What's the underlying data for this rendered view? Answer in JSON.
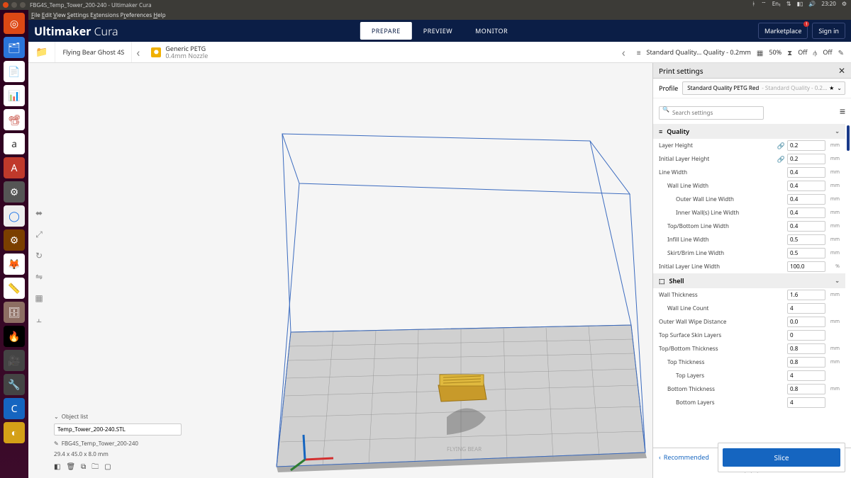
{
  "window": {
    "title": "FBG4S_Temp_Tower_200-240 - Ultimaker Cura"
  },
  "wm_circles": [
    "#df4a16",
    "#5b5750",
    "#5b5750"
  ],
  "tray": {
    "lang": "En₁",
    "time": "23:20"
  },
  "menubar": [
    "File",
    "Edit",
    "View",
    "Settings",
    "Extensions",
    "Preferences",
    "Help"
  ],
  "launcher": [
    {
      "bg": "#dd4814",
      "glyph": "◎"
    },
    {
      "bg": "#2a74da",
      "glyph": "🗂"
    },
    {
      "bg": "#0b6e4f",
      "glyph": "📗"
    },
    {
      "bg": "#ffffff",
      "glyph": "📝"
    },
    {
      "bg": "#0b6e4f",
      "glyph": "📊"
    },
    {
      "bg": "#c0392b",
      "glyph": "📽"
    },
    {
      "bg": "#ffffff",
      "glyph": "a"
    },
    {
      "bg": "#c0392b",
      "glyph": "🛍"
    },
    {
      "bg": "#555",
      "glyph": "⚙"
    },
    {
      "bg": "#ddd",
      "glyph": "🌐"
    },
    {
      "bg": "#7b3f00",
      "glyph": "⚙"
    },
    {
      "bg": "#ff7043",
      "glyph": "🦊"
    },
    {
      "bg": "#ddd",
      "glyph": "📏"
    },
    {
      "bg": "#8d6e63",
      "glyph": "🗄"
    },
    {
      "bg": "#000",
      "glyph": "🔥"
    },
    {
      "bg": "#444",
      "glyph": "🎥"
    },
    {
      "bg": "#444",
      "glyph": "⚙"
    },
    {
      "bg": "#1565c0",
      "glyph": "C"
    },
    {
      "bg": "#d4a017",
      "glyph": "◐"
    }
  ],
  "brand_a": "Ultimaker",
  "brand_b": " Cura",
  "stages": {
    "prepare": "PREPARE",
    "preview": "PREVIEW",
    "monitor": "MONITOR"
  },
  "header_right": {
    "marketplace": "Marketplace",
    "signin": "Sign in",
    "notif": "1"
  },
  "toolbar": {
    "printer": "Flying Bear Ghost 4S",
    "material": "Generic PETG",
    "nozzle": "0.4mm Nozzle",
    "summary": "Standard Quality... Quality - 0.2mm",
    "infill": "50%",
    "support": "Off",
    "adhesion": "Off"
  },
  "sidebar": {
    "title": "Print settings",
    "profile_label": "Profile",
    "profile_name": "Standard Quality PETG Red",
    "profile_sub": "- Standard Quality - 0.2…",
    "search_placeholder": "Search settings",
    "quality_header": "Quality",
    "shell_header": "Shell",
    "settings": {
      "layer_height": {
        "label": "Layer Height",
        "value": "0.2",
        "unit": "mm",
        "linked": true,
        "indent": 0
      },
      "init_layer_height": {
        "label": "Initial Layer Height",
        "value": "0.2",
        "unit": "mm",
        "linked": true,
        "indent": 0
      },
      "line_width": {
        "label": "Line Width",
        "value": "0.4",
        "unit": "mm",
        "indent": 0
      },
      "wall_line_width": {
        "label": "Wall Line Width",
        "value": "0.4",
        "unit": "mm",
        "indent": 1
      },
      "outer_wall_lw": {
        "label": "Outer Wall Line Width",
        "value": "0.4",
        "unit": "mm",
        "indent": 2
      },
      "inner_wall_lw": {
        "label": "Inner Wall(s) Line Width",
        "value": "0.4",
        "unit": "mm",
        "indent": 2
      },
      "tb_line_width": {
        "label": "Top/Bottom Line Width",
        "value": "0.4",
        "unit": "mm",
        "indent": 1
      },
      "infill_lw": {
        "label": "Infill Line Width",
        "value": "0.5",
        "unit": "mm",
        "indent": 1
      },
      "skirt_lw": {
        "label": "Skirt/Brim Line Width",
        "value": "0.5",
        "unit": "mm",
        "indent": 1
      },
      "init_layer_lw": {
        "label": "Initial Layer Line Width",
        "value": "100.0",
        "unit": "%",
        "indent": 0
      },
      "wall_thickness": {
        "label": "Wall Thickness",
        "value": "1.6",
        "unit": "mm",
        "indent": 0
      },
      "wall_line_count": {
        "label": "Wall Line Count",
        "value": "4",
        "unit": "",
        "indent": 1
      },
      "outer_wipe": {
        "label": "Outer Wall Wipe Distance",
        "value": "0.0",
        "unit": "mm",
        "indent": 0
      },
      "top_skin": {
        "label": "Top Surface Skin Layers",
        "value": "0",
        "unit": "",
        "indent": 0
      },
      "tb_thickness": {
        "label": "Top/Bottom Thickness",
        "value": "0.8",
        "unit": "mm",
        "indent": 0
      },
      "top_thickness": {
        "label": "Top Thickness",
        "value": "0.8",
        "unit": "mm",
        "indent": 1
      },
      "top_layers": {
        "label": "Top Layers",
        "value": "4",
        "unit": "",
        "indent": 2
      },
      "bottom_thickness": {
        "label": "Bottom Thickness",
        "value": "0.8",
        "unit": "mm",
        "indent": 1
      },
      "bottom_layers": {
        "label": "Bottom Layers",
        "value": "4",
        "unit": "",
        "indent": 2
      }
    },
    "recommended": "Recommended"
  },
  "object_panel": {
    "title": "Object list",
    "item": "Temp_Tower_200-240.STL",
    "file_label": "FBG4S_Temp_Tower_200-240",
    "dims": "29.4 x 45.0 x 8.0 mm"
  },
  "slice": "Slice"
}
